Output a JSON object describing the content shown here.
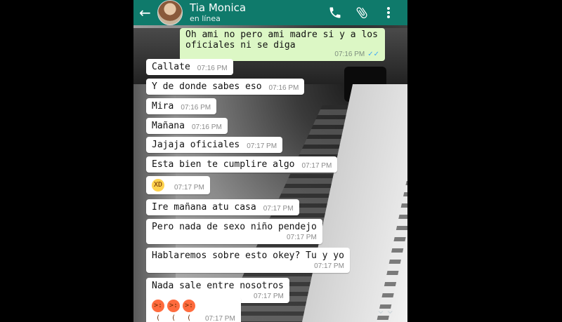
{
  "header": {
    "contact_name": "Tia Monica",
    "status": "en línea",
    "back_icon": "arrow-left",
    "call_icon": "phone",
    "attach_icon": "paperclip",
    "menu_icon": "more-vertical"
  },
  "outgoing": {
    "text": "Oh ami no pero ami madre  si y a los oficiales ni se diga",
    "time": "07:16 PM"
  },
  "messages": [
    {
      "text": "Callate",
      "time": "07:16 PM"
    },
    {
      "text": "Y de donde sabes eso",
      "time": "07:16 PM"
    },
    {
      "text": "Mira",
      "time": "07:16 PM"
    },
    {
      "text": "Mañana",
      "time": "07:16 PM"
    },
    {
      "text": "Jajaja oficiales",
      "time": "07:17 PM"
    },
    {
      "text": "Esta bien te cumplire algo",
      "time": "07:17 PM"
    },
    {
      "text": "",
      "time": "07:17 PM",
      "emoji": [
        "laughing-face"
      ]
    },
    {
      "text": "Ire mañana atu casa",
      "time": "07:17 PM"
    },
    {
      "text": "Pero nada de sexo niño pendejo",
      "time": "07:17 PM"
    },
    {
      "text": "Hablaremos sobre esto okey? Tu y yo",
      "time": "07:17 PM"
    },
    {
      "text": "Nada sale entre nosotros",
      "time": "07:17 PM"
    },
    {
      "text": "",
      "time": "07:17 PM",
      "emoji": [
        "angry-face",
        "angry-face",
        "angry-face"
      ]
    }
  ],
  "colors": {
    "header": "#0f7a6b",
    "outgoing_bubble": "#dcf7c5",
    "incoming_bubble": "#ffffff",
    "read_ticks": "#3fa9f5"
  }
}
